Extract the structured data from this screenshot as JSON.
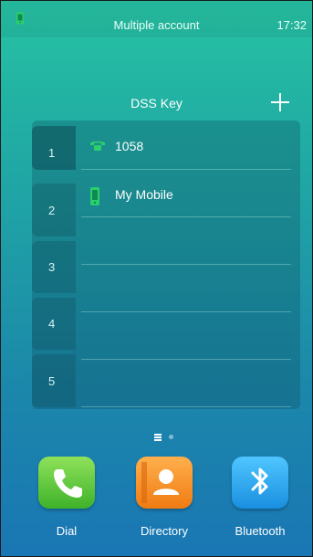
{
  "status_bar": {
    "title": "Multiple account",
    "time": "17:32"
  },
  "dss": {
    "title": "DSS Key",
    "tabs": [
      "1",
      "2",
      "3",
      "4",
      "5"
    ],
    "active_tab": "1",
    "rows": [
      {
        "label": "1058",
        "icon": "phone-icon",
        "color": "#2ad06a"
      },
      {
        "label": "My Mobile",
        "icon": "mobile-icon",
        "color": "#2ad06a"
      }
    ]
  },
  "pager": {
    "current_page": 1,
    "total_pages": 2
  },
  "dock": [
    {
      "label": "Dial",
      "icon": "phone-icon"
    },
    {
      "label": "Directory",
      "icon": "contact-icon"
    },
    {
      "label": "Bluetooth",
      "icon": "bluetooth-icon"
    }
  ]
}
